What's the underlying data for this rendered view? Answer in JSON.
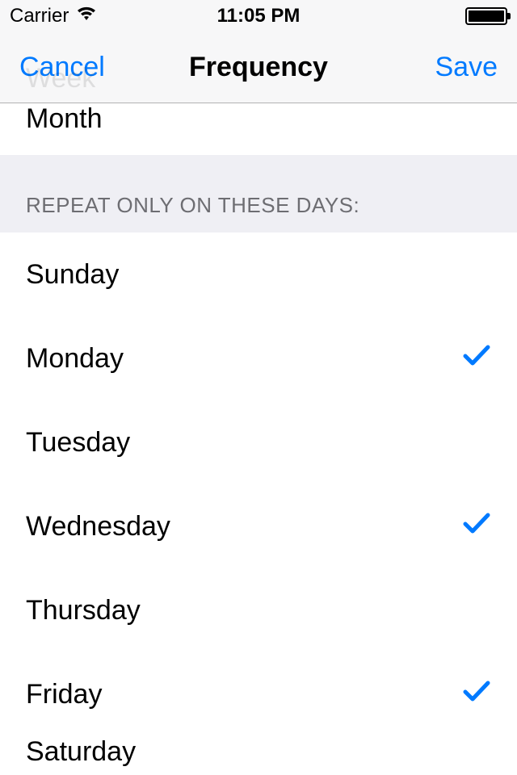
{
  "statusBar": {
    "carrier": "Carrier",
    "time": "11:05 PM"
  },
  "nav": {
    "cancel": "Cancel",
    "title": "Frequency",
    "save": "Save"
  },
  "periodRow": {
    "label": "Month"
  },
  "fadedPrevious": "Week",
  "sectionHeader": "REPEAT ONLY ON THESE DAYS:",
  "days": [
    {
      "label": "Sunday",
      "checked": false
    },
    {
      "label": "Monday",
      "checked": true
    },
    {
      "label": "Tuesday",
      "checked": false
    },
    {
      "label": "Wednesday",
      "checked": true
    },
    {
      "label": "Thursday",
      "checked": false
    },
    {
      "label": "Friday",
      "checked": true
    },
    {
      "label": "Saturday",
      "checked": false
    }
  ]
}
